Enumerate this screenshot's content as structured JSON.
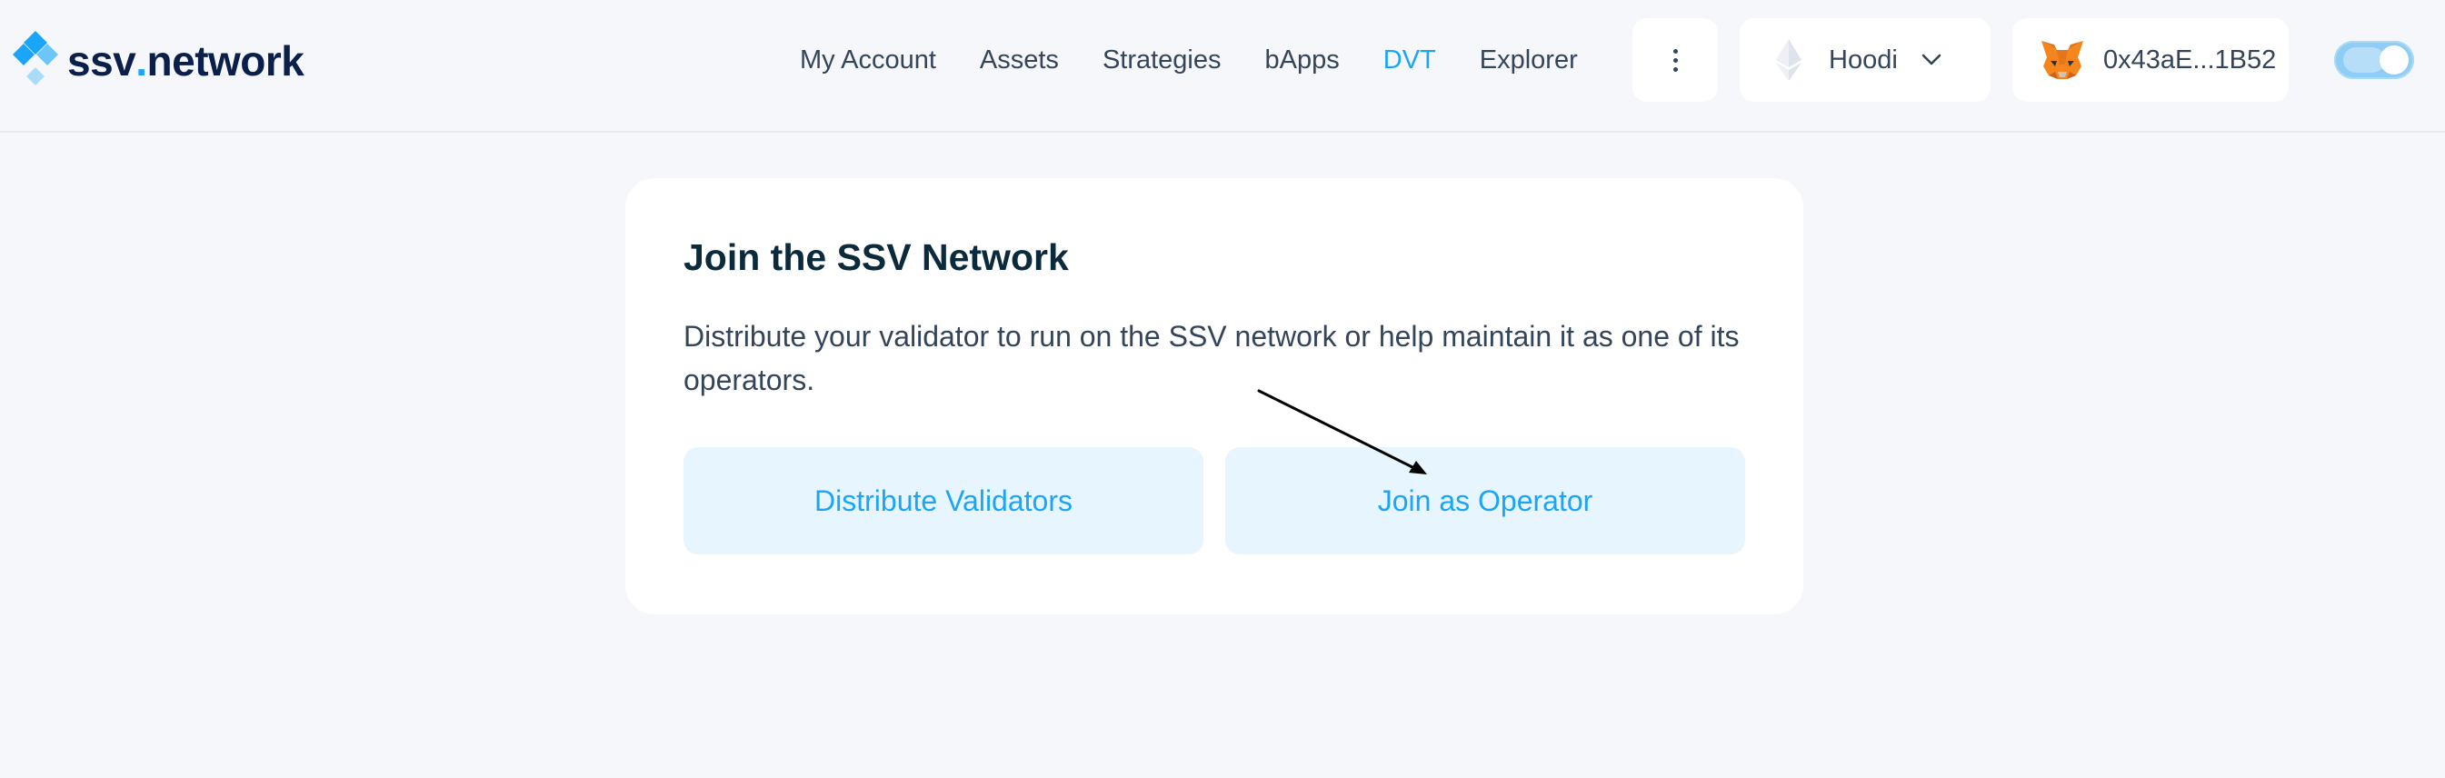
{
  "header": {
    "logo": {
      "text_main": "ssv",
      "text_dot": ".",
      "text_suffix": "network"
    },
    "nav": [
      {
        "label": "My Account",
        "active": false
      },
      {
        "label": "Assets",
        "active": false
      },
      {
        "label": "Strategies",
        "active": false
      },
      {
        "label": "bApps",
        "active": false
      },
      {
        "label": "DVT",
        "active": true
      },
      {
        "label": "Explorer",
        "active": false
      }
    ],
    "more_icon": "vertical-dots-icon",
    "network": {
      "label": "Hoodi",
      "icon": "ethereum-icon",
      "chevron": "chevron-down-icon"
    },
    "wallet": {
      "address": "0x43aE...1B52",
      "icon": "metamask-fox-icon"
    },
    "theme_toggle": {
      "on": true
    }
  },
  "card": {
    "title": "Join the SSV Network",
    "description": "Distribute your validator to run on the SSV network or help maintain it as one of its operators.",
    "buttons": {
      "distribute": "Distribute Validators",
      "operator": "Join as Operator"
    }
  },
  "colors": {
    "accent": "#1ba5f8",
    "button_bg": "#e7f6fe",
    "page_bg": "#f6f7fa",
    "title": "#0b2a3c"
  }
}
